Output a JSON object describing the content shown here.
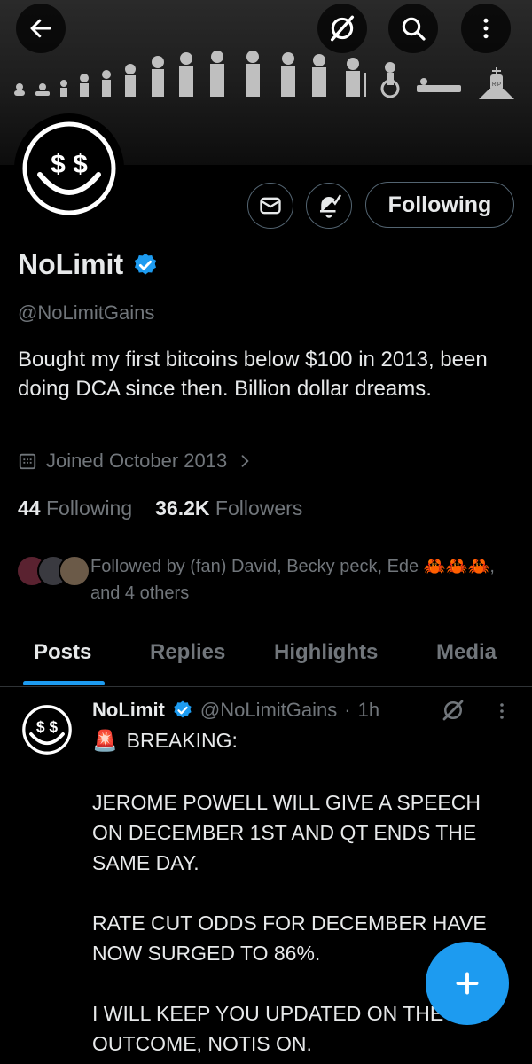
{
  "header": {
    "back_icon": "arrow-left-icon",
    "grok_icon": "slash-circle-icon",
    "search_icon": "search-icon",
    "more_icon": "more-vertical-icon",
    "banner_tombstone_text": "RIP"
  },
  "profile": {
    "avatar_text": "$ $",
    "name": "NoLimit",
    "handle": "@NoLimitGains",
    "bio": "Bought my first bitcoins below $100 in 2013, been doing DCA since then. Billion dollar dreams.",
    "joined": "Joined October 2013",
    "following_count": "44",
    "following_label": "Following",
    "followers_count": "36.2K",
    "followers_label": "Followers",
    "followed_by": "Followed by (fan) David, Becky peck, Ede 🦀🦀🦀, and 4 others",
    "follow_button": "Following",
    "verified_color": "#1d9bf0"
  },
  "tabs": [
    {
      "label": "Posts",
      "active": true
    },
    {
      "label": "Replies",
      "active": false
    },
    {
      "label": "Highlights",
      "active": false
    },
    {
      "label": "Media",
      "active": false
    }
  ],
  "post": {
    "author": "NoLimit",
    "handle": "@NoLimitGains",
    "separator": "·",
    "time": "1h",
    "siren": "🚨",
    "headline": "BREAKING:",
    "body": "JEROME POWELL WILL GIVE A SPEECH ON DECEMBER 1ST AND QT ENDS THE SAME DAY.\n\nRATE CUT ODDS FOR DECEMBER HAVE NOW SURGED TO 86%.\n\nI WILL KEEP YOU UPDATED ON THE OUTCOME, NOTIS ON."
  },
  "fab": {
    "icon": "plus-icon",
    "color": "#1d9bf0"
  }
}
